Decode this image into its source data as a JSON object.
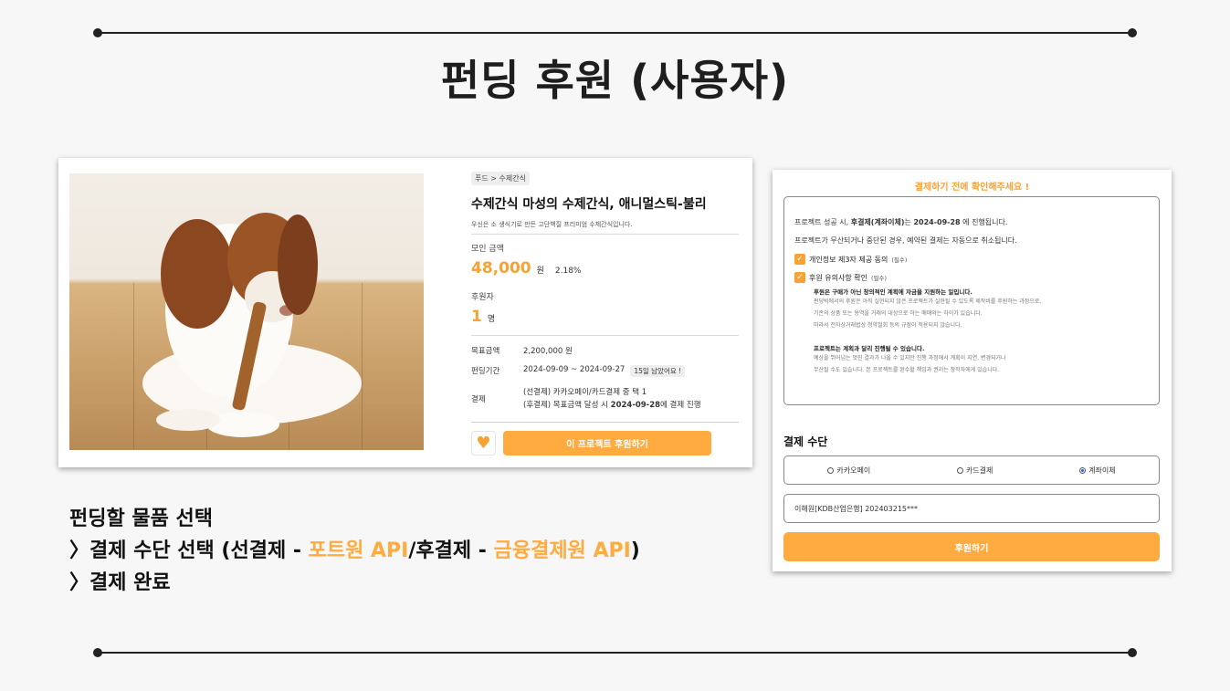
{
  "slide": {
    "title": "펀딩 후원 (사용자)",
    "step1": "펀딩할 물품 선택",
    "step2_prefix": "〉결제 수단 선택 (선결제 - ",
    "step2_accent1": "포트원 API",
    "step2_mid": "/후결제 - ",
    "step2_accent2": "금융결제원 API",
    "step2_suffix": ")",
    "step3": "〉결제 완료"
  },
  "product": {
    "breadcrumb": "푸드 > 수제간식",
    "title": "수제간식 마성의 수제간식, 애니멀스틱-불리",
    "subtitle": "우신은 소 생식기로 만든 고단백질 프리미엄 수제간식입니다.",
    "raised_label": "모인 금액",
    "raised_amount": "48,000",
    "raised_unit": "원",
    "raised_percent": "2.18%",
    "supporters_label": "후원자",
    "supporters_count": "1",
    "supporters_unit": "명",
    "goal_label": "목표금액",
    "goal_value": "2,200,000 원",
    "period_label": "펀딩기간",
    "period_value": "2024-09-09 ~ 2024-09-27",
    "period_badge": "15일 남았어요 !",
    "payment_label": "결제",
    "payment_line1": "(선결제) 카카오페이/카드결제 중 택 1",
    "payment_line2_prefix": "(후결제) 목표금액 달성 시 ",
    "payment_line2_date": "2024-09-28",
    "payment_line2_suffix": "에 결제 진행",
    "support_button": "이 프로젝트 후원하기",
    "heart_icon": "heart-icon"
  },
  "payment": {
    "header": "결제하기 전에 확인해주세요 !",
    "notice_line1_prefix": "프로젝트 성공 시, ",
    "notice_line1_bold": "후결제(계좌이체)",
    "notice_line1_mid": "는 ",
    "notice_line1_date": "2024-09-28",
    "notice_line1_suffix": " 에 진행됩니다.",
    "notice_line2": "프로젝트가 무산되거나 중단된 경우, 예약된 결제는 자동으로 취소됩니다.",
    "consent1": "개인정보 제3자 제공 동의",
    "consent1_tag": "(필수)",
    "consent2": "후원 유의사항 확인",
    "consent2_tag": "(필수)",
    "fine_h1": "후원은 구매가 아닌 창의적인 계획에 자금을 지원하는 일입니다.",
    "fine_t1": "펀딩빅에서의 후원은 아직 실현되지 않은 프로젝트가 실현될 수 있도록 제작비를 후원하는 과정으로,",
    "fine_t2": "기존의 상품 또는 용역을 거래의 대상으로 하는 매매와는 차이가 있습니다.",
    "fine_t3": "따라서 전자상거래법상 청약철회 등의 규정이 적용되지 않습니다.",
    "fine_h2": "프로젝트는 계획과 달리 진행될 수 있습니다.",
    "fine_t4": "예상을 뛰어넘는 멋진 결과가 나올 수 있지만 진행 과정에서 계획이 지연, 변경되거나",
    "fine_t5": "무산될 수도 있습니다. 본 프로젝트를 완수할 책임과 권리는 창작자에게 있습니다.",
    "method_label": "결제 수단",
    "methods": [
      "카카오페이",
      "카드결제",
      "계좌이체"
    ],
    "selected_method": "계좌이체",
    "account": "이해원[KDB산업은행] 202403215***",
    "pay_button": "후원하기"
  },
  "colors": {
    "accent": "#ffab40",
    "accent_text": "#f7a233",
    "background": "#f7f7f7"
  }
}
